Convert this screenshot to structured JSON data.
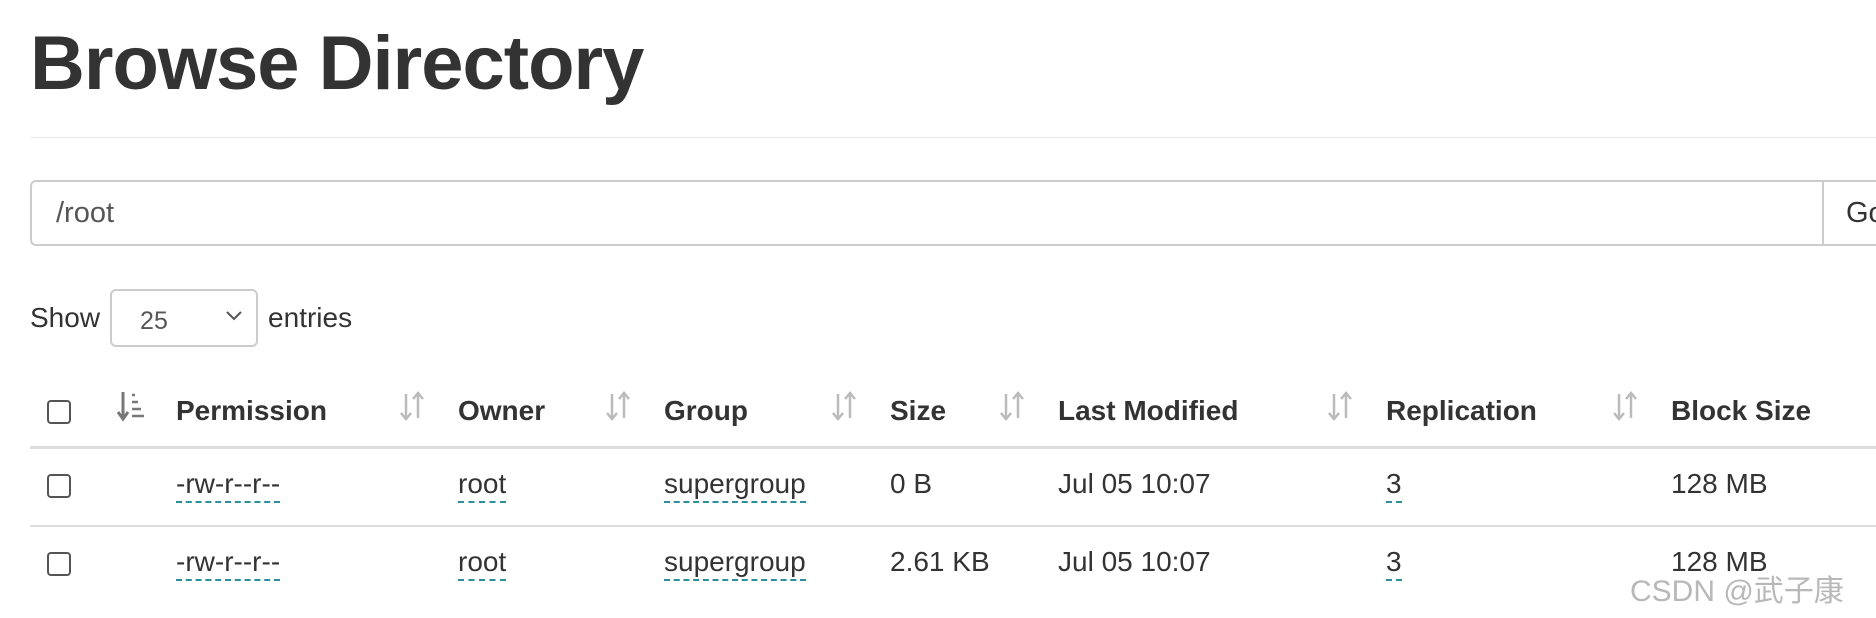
{
  "page": {
    "title": "Browse Directory"
  },
  "path_bar": {
    "value": "/root",
    "go_label": "Go!"
  },
  "entries_control": {
    "show_label": "Show",
    "selected": "25",
    "suffix": "entries"
  },
  "table": {
    "columns": [
      "Permission",
      "Owner",
      "Group",
      "Size",
      "Last Modified",
      "Replication",
      "Block Size"
    ],
    "rows": [
      {
        "permission": "-rw-r--r--",
        "owner": "root",
        "group": "supergroup",
        "size": "0 B",
        "last_modified": "Jul 05 10:07",
        "replication": "3",
        "block_size": "128 MB"
      },
      {
        "permission": "-rw-r--r--",
        "owner": "root",
        "group": "supergroup",
        "size": "2.61 KB",
        "last_modified": "Jul 05 10:07",
        "replication": "3",
        "block_size": "128 MB"
      }
    ]
  },
  "watermark": "CSDN @武子康",
  "icons": {
    "sort_active": "sort-amount-down-icon",
    "sort": "sort-both-icon",
    "select_chevron": "chevron-down-icon"
  },
  "colors": {
    "text": "#333333",
    "link_underline": "#2a8f9e",
    "border": "#cccccc",
    "sort_icon": "#bbbbbb"
  }
}
